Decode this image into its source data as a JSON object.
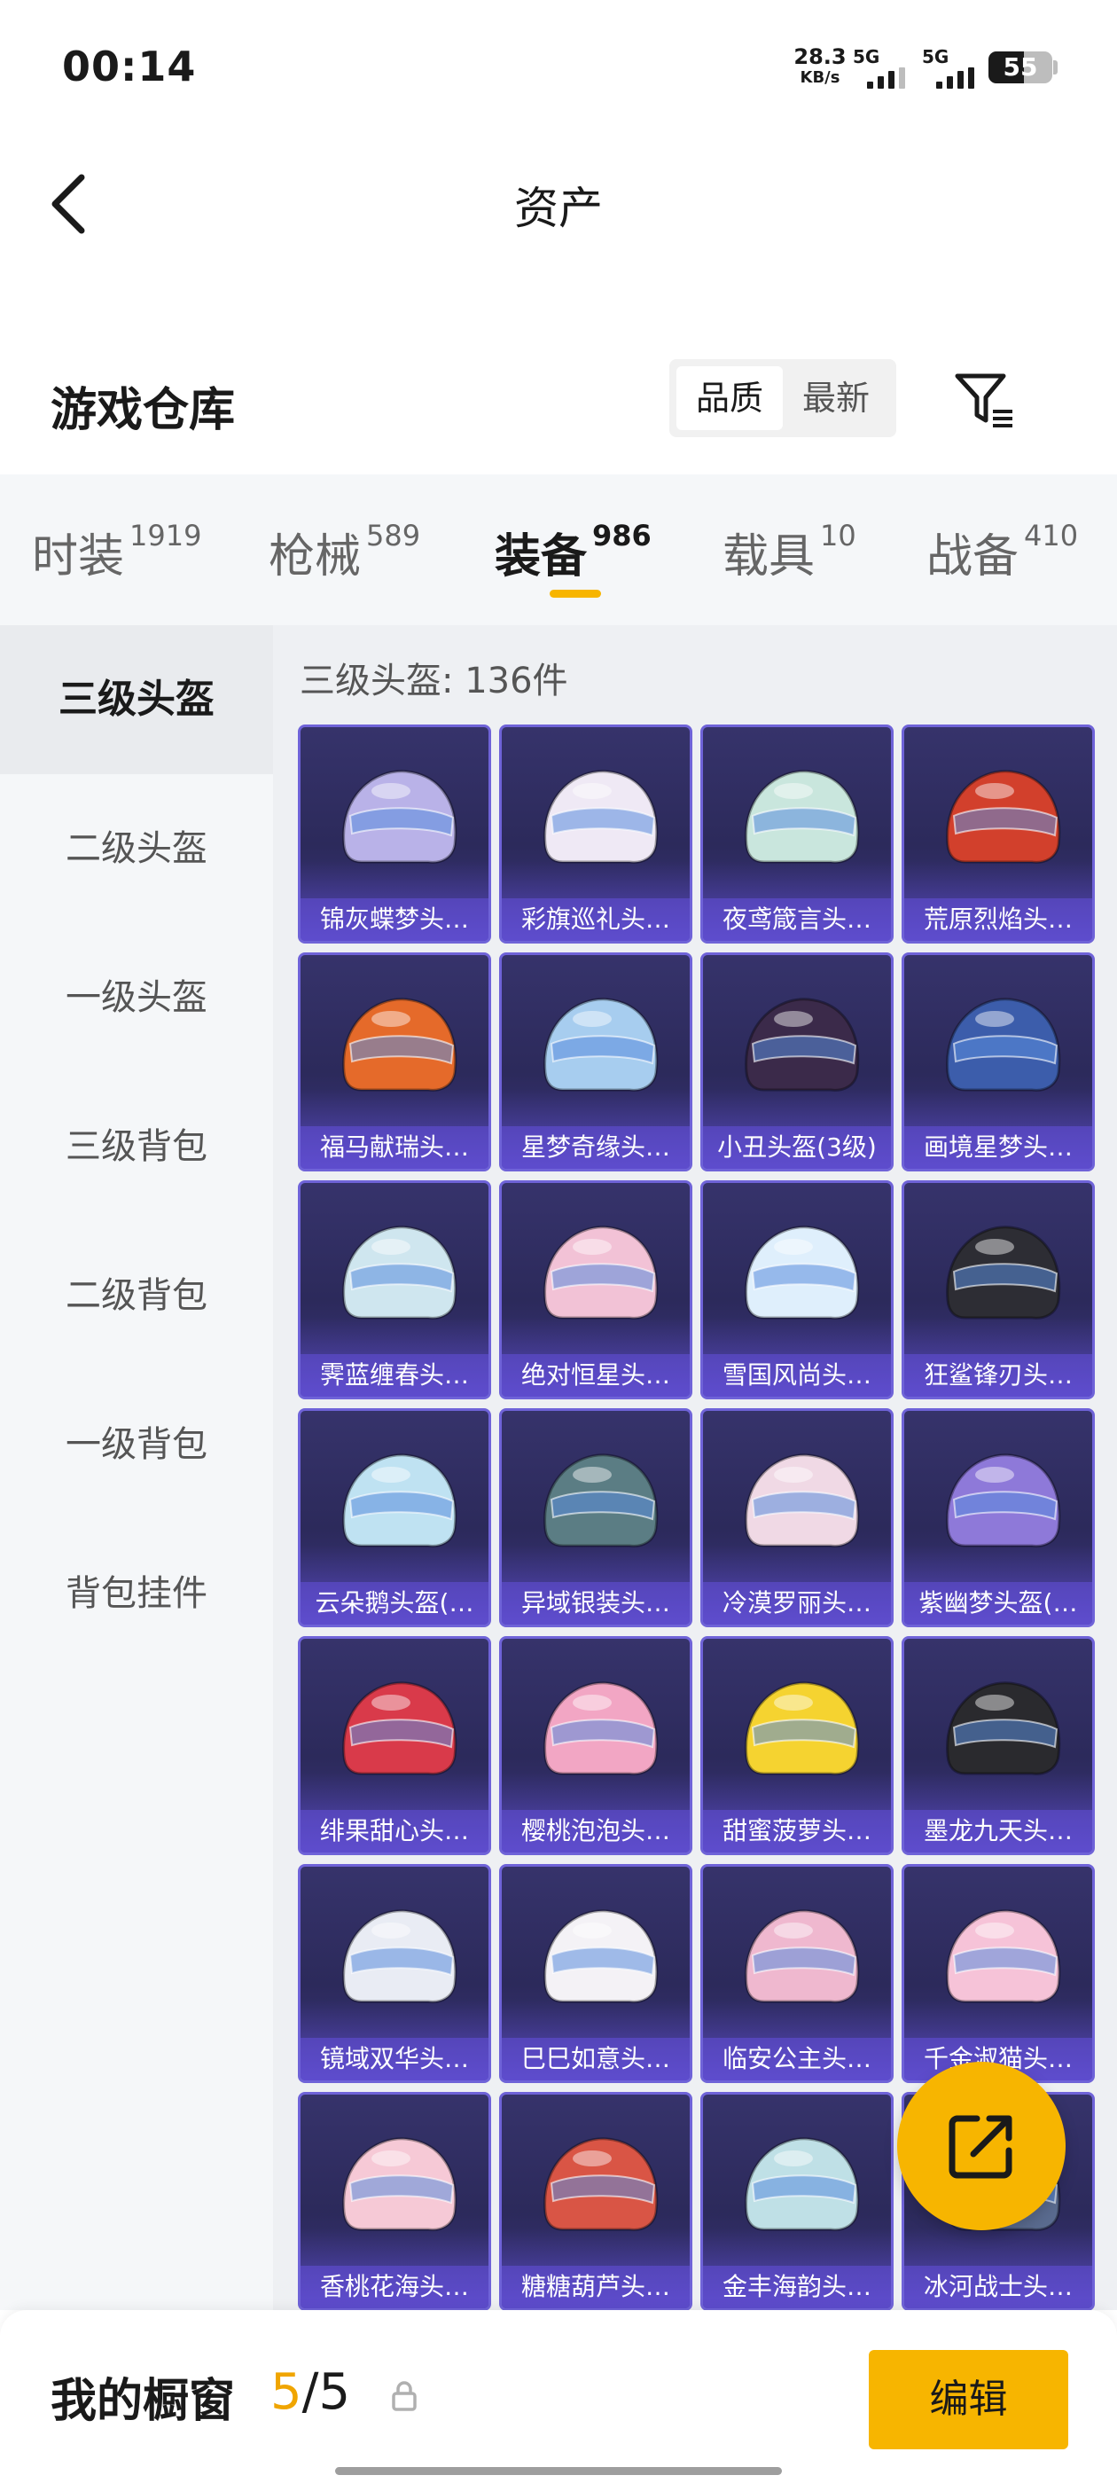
{
  "status_bar": {
    "time": "00:14",
    "net_speed_value": "28.3",
    "net_speed_unit": "KB/s",
    "signal1_label": "5G",
    "signal2_label": "5G",
    "battery": "55"
  },
  "nav": {
    "title": "资产",
    "back_icon": "chevron-left-icon"
  },
  "header": {
    "title": "游戏仓库",
    "sort_options": [
      "品质",
      "最新"
    ],
    "sort_active": "品质",
    "filter_icon": "filter-icon"
  },
  "tabs": [
    {
      "label": "时装",
      "count": "1919",
      "active": false
    },
    {
      "label": "枪械",
      "count": "589",
      "active": false
    },
    {
      "label": "装备",
      "count": "986",
      "active": true
    },
    {
      "label": "载具",
      "count": "10",
      "active": false
    },
    {
      "label": "战备",
      "count": "410",
      "active": false
    }
  ],
  "sidebar": {
    "items": [
      "三级头盔",
      "二级头盔",
      "一级头盔",
      "三级背包",
      "二级背包",
      "一级背包",
      "背包挂件"
    ],
    "active": "三级头盔"
  },
  "list": {
    "count_label": "三级头盔: 136件",
    "items": [
      {
        "name": "锦灰蝶梦头…",
        "color": "#b9b2e8"
      },
      {
        "name": "彩旗巡礼头…",
        "color": "#efe9f5"
      },
      {
        "name": "夜鸢箴言头…",
        "color": "#c9e6dd"
      },
      {
        "name": "荒原烈焰头…",
        "color": "#d2402c"
      },
      {
        "name": "福马献瑞头…",
        "color": "#e56a2a"
      },
      {
        "name": "星梦奇缘头…",
        "color": "#a7cdef"
      },
      {
        "name": "小丑头盔(3级)",
        "color": "#3b2a4a"
      },
      {
        "name": "画境星梦头…",
        "color": "#3c5dab"
      },
      {
        "name": "霁蓝缠春头…",
        "color": "#cfe6ef"
      },
      {
        "name": "绝对恒星头…",
        "color": "#f2c2d6"
      },
      {
        "name": "雪国风尚头…",
        "color": "#dfeffc"
      },
      {
        "name": "狂鲨锋刃头…",
        "color": "#2d2d34"
      },
      {
        "name": "云朵鹅头盔(…",
        "color": "#bfe2f2"
      },
      {
        "name": "异域银装头…",
        "color": "#5b7d84"
      },
      {
        "name": "冷漠罗丽头…",
        "color": "#f0d9e5"
      },
      {
        "name": "紫幽梦头盔(…",
        "color": "#8e79d9"
      },
      {
        "name": "绯果甜心头…",
        "color": "#d93a4a"
      },
      {
        "name": "樱桃泡泡头…",
        "color": "#f2a6c4"
      },
      {
        "name": "甜蜜菠萝头…",
        "color": "#f5d330"
      },
      {
        "name": "墨龙九天头…",
        "color": "#2a2a2e"
      },
      {
        "name": "镜域双华头…",
        "color": "#e9ecf4"
      },
      {
        "name": "巳巳如意头…",
        "color": "#f4f2f6"
      },
      {
        "name": "临安公主头…",
        "color": "#efb8cf"
      },
      {
        "name": "千金淑猫头…",
        "color": "#f6c3d8"
      },
      {
        "name": "香桃花海头…",
        "color": "#f6c9d6"
      },
      {
        "name": "糖糖葫芦头…",
        "color": "#d95545"
      },
      {
        "name": "金丰海韵头…",
        "color": "#bfe0e6"
      },
      {
        "name": "冰河战士头…",
        "color": "#5a6b8f"
      }
    ]
  },
  "fab": {
    "icon": "share-icon"
  },
  "bottom_bar": {
    "label": "我的橱窗",
    "count_current": "5",
    "count_total": "/5",
    "lock_icon": "lock-icon",
    "edit_label": "编辑"
  },
  "colors": {
    "accent": "#f7b500",
    "card_border": "#6f63d8",
    "card_bg": "#2c2a5b"
  }
}
